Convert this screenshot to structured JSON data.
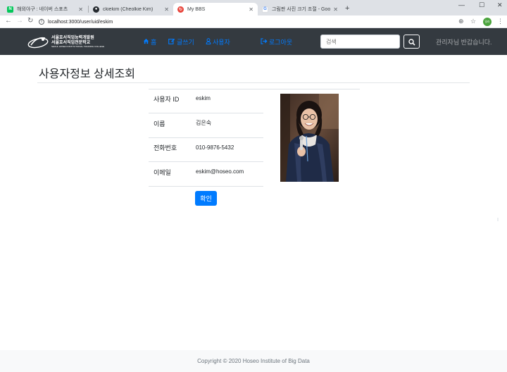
{
  "browser": {
    "tabs": [
      {
        "title": "해외야구 : 네이버 스포츠",
        "favicon": "naver-icon",
        "active": false
      },
      {
        "title": "ckiekim (Cheolkie Kim)",
        "favicon": "github-icon",
        "active": false
      },
      {
        "title": "My BBS",
        "favicon": "reload-icon",
        "active": true
      },
      {
        "title": "그림판 사진 크기 조절 - Google",
        "favicon": "google-icon",
        "active": false
      }
    ],
    "url": "localhost:3000/user/uid/eskim",
    "profile_label": "일라"
  },
  "navbar": {
    "logo": {
      "line1": "서울호서직업능력개발원",
      "line2": "서울호서직업전문학교",
      "line3": "SEOUL HOSEO INSTITUTIONAL TRAINING COLLEGE"
    },
    "links": [
      {
        "label": "홈",
        "icon": "home-icon"
      },
      {
        "label": "글쓰기",
        "icon": "edit-icon"
      },
      {
        "label": "사용자",
        "icon": "users-icon"
      },
      {
        "label": "로그아웃",
        "icon": "sign-out-icon"
      }
    ],
    "search_placeholder": "검색",
    "welcome": "관리자님 반갑습니다."
  },
  "page": {
    "title": "사용자정보 상세조회",
    "fields": [
      {
        "label": "사용자 ID",
        "value": "eskim"
      },
      {
        "label": "이름",
        "value": "김은숙"
      },
      {
        "label": "전화번호",
        "value": "010-9876-5432"
      },
      {
        "label": "이메일",
        "value": "eskim@hoseo.com"
      }
    ],
    "confirm_label": "확인"
  },
  "footer": {
    "text": "Copyright © 2020 Hoseo Institute of Big Data"
  },
  "colors": {
    "navbar_bg": "#343a40",
    "link": "#007bff",
    "primary": "#007bff",
    "footer_bg": "#f8f9fa"
  }
}
